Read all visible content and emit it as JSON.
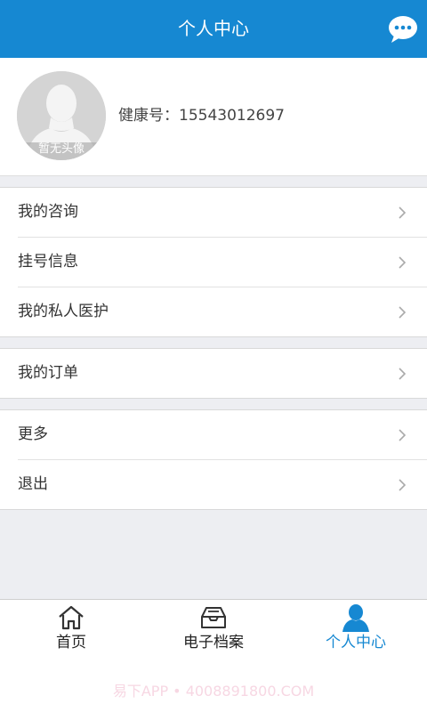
{
  "header": {
    "title": "个人中心"
  },
  "profile": {
    "avatar_caption": "暂无头像",
    "health_id_label": "健康号：",
    "health_id_value": "15543012697"
  },
  "menu_groups": [
    {
      "items": [
        {
          "label": "我的咨询"
        },
        {
          "label": "挂号信息"
        },
        {
          "label": "我的私人医护"
        }
      ]
    },
    {
      "items": [
        {
          "label": "我的订单"
        }
      ]
    },
    {
      "items": [
        {
          "label": "更多"
        },
        {
          "label": "退出"
        }
      ]
    }
  ],
  "tabbar": {
    "tabs": [
      {
        "label": "首页",
        "icon": "home-icon",
        "active": false
      },
      {
        "label": "电子档案",
        "icon": "inbox-tray-icon",
        "active": false
      },
      {
        "label": "个人中心",
        "icon": "person-icon",
        "active": true
      }
    ]
  },
  "watermark": "易下APP • 4008891800.COM",
  "colors": {
    "accent": "#1688d2",
    "background": "#edeef2",
    "text": "#333333"
  }
}
